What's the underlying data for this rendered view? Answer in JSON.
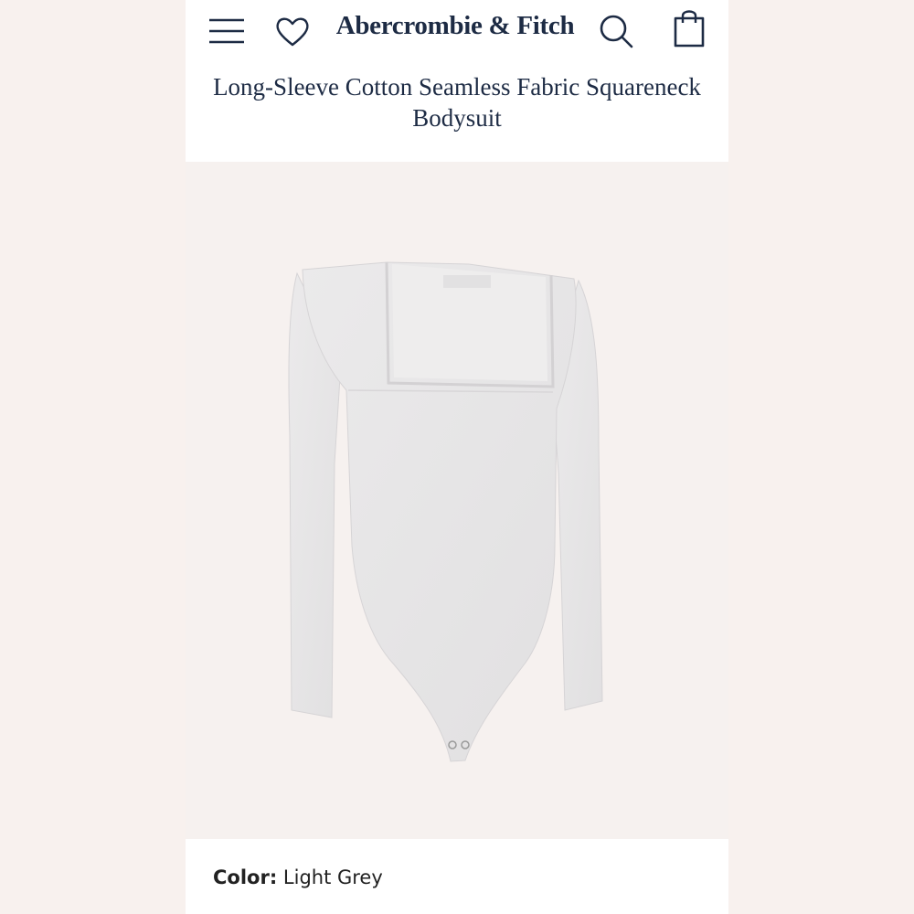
{
  "header": {
    "brand": "Abercrombie & Fitch",
    "icons": {
      "menu": "hamburger-menu-icon",
      "wishlist": "heart-icon",
      "search": "search-icon",
      "bag": "shopping-bag-icon"
    }
  },
  "product": {
    "title": "Long-Sleeve Cotton Seamless Fabric Squareneck Bodysuit",
    "color_label": "Color:",
    "color_value": "Light Grey"
  },
  "colors": {
    "brand_navy": "#1d2b44",
    "garment_grey": "#e6e5e6",
    "image_bg": "#f6f1ef"
  }
}
